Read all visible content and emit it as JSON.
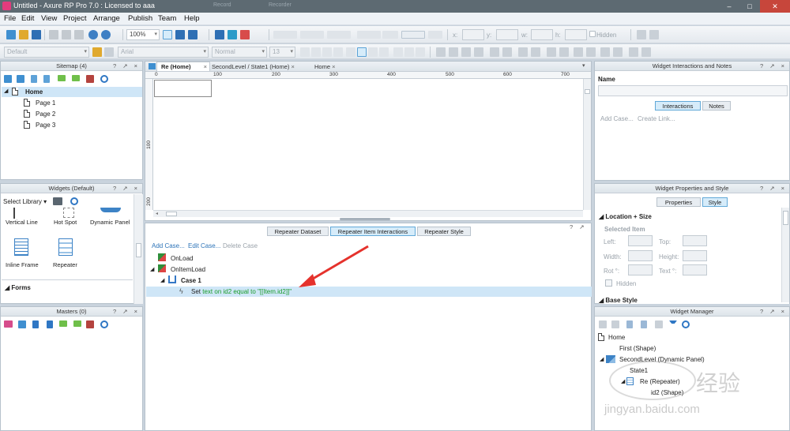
{
  "window": {
    "title": "Untitled - Axure RP Pro 7.0 : Licensed to aaa",
    "ghost_tabs": [
      "Record",
      "Recorder"
    ]
  },
  "menu": [
    "File",
    "Edit",
    "View",
    "Project",
    "Arrange",
    "Publish",
    "Team",
    "Help"
  ],
  "toolbar": {
    "zoom": "100%",
    "style_select": "Default",
    "font_select": "Arial",
    "weight_select": "Normal",
    "size_select": "13",
    "x_label": "x:",
    "y_label": "y:",
    "w_label": "w:",
    "h_label": "h:",
    "hidden_label": "Hidden"
  },
  "sitemap": {
    "title": "Sitemap (4)",
    "controls": "? ↗ ×",
    "pages": [
      "Home",
      "Page 1",
      "Page 2",
      "Page 3"
    ]
  },
  "widgets": {
    "title": "Widgets (Default)",
    "controls": "? ↗ ×",
    "select_library": "Select Library",
    "items": [
      "Vertical Line",
      "Hot Spot",
      "Dynamic Panel",
      "Inline Frame",
      "Repeater"
    ],
    "section": "Forms"
  },
  "masters": {
    "title": "Masters (0)",
    "controls": "? ↗ ×"
  },
  "canvas": {
    "tabs": [
      "Re (Home)",
      "SecondLevel / State1 (Home)",
      "Home"
    ],
    "ruler_top": [
      "0",
      "100",
      "200",
      "300",
      "400",
      "500",
      "600",
      "700"
    ],
    "ruler_left": [
      "100",
      "200"
    ]
  },
  "repeater": {
    "controls": "? ↗",
    "tabs": [
      "Repeater Dataset",
      "Repeater Item Interactions",
      "Repeater Style"
    ],
    "add_case": "Add Case...",
    "edit_case": "Edit Case...",
    "delete_case": "Delete Case",
    "events": [
      "OnLoad",
      "OnItemLoad"
    ],
    "case": "Case 1",
    "action_verb": "Set",
    "action_text": "text on id2 equal to \"[[Item.id2]]\""
  },
  "interactions": {
    "title": "Widget Interactions and Notes",
    "controls": "? ↗ ×",
    "name_label": "Name",
    "tab_interactions": "Interactions",
    "tab_notes": "Notes",
    "add_case": "Add Case...",
    "create_link": "Create Link..."
  },
  "properties": {
    "title": "Widget Properties and Style",
    "controls": "? ↗ ×",
    "tab_properties": "Properties",
    "tab_style": "Style",
    "location_size": "Location + Size",
    "selected_item": "Selected Item",
    "left": "Left:",
    "top": "Top:",
    "width": "Width:",
    "height": "Height:",
    "rot": "Rot °:",
    "text": "Text °:",
    "hidden": "Hidden",
    "base_style": "Base Style"
  },
  "manager": {
    "title": "Widget Manager",
    "controls": "? ↗ ×",
    "items": [
      "Home",
      "First (Shape)",
      "SecondLevel (Dynamic Panel)",
      "State1",
      "Re (Repeater)",
      "id2 (Shape)"
    ]
  },
  "watermark": {
    "text": "经验",
    "url": "jingyan.baidu.com"
  }
}
